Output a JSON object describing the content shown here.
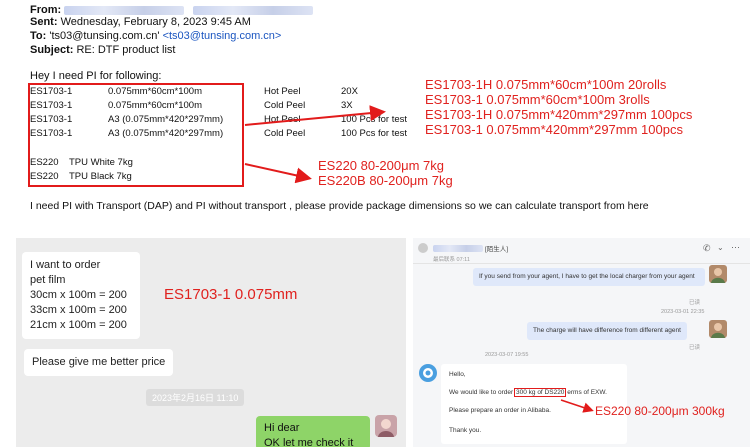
{
  "email": {
    "from_label": "From:",
    "sent_label": "Sent:",
    "sent_value": "Wednesday, February 8, 2023 9:45 AM",
    "to_label": "To:",
    "to_name": "'ts03@tunsing.com.cn'",
    "to_email": "<ts03@tunsing.com.cn>",
    "subject_label": "Subject:",
    "subject_value": "RE: DTF product list",
    "intro": "Hey I need PI for following:",
    "products": [
      {
        "code": "ES1703-1",
        "spec": "0.075mm*60cm*100m",
        "type": "Hot Peel",
        "qty": "20X"
      },
      {
        "code": "ES1703-1",
        "spec": "0.075mm*60cm*100m",
        "type": "Cold Peel",
        "qty": "3X"
      },
      {
        "code": "ES1703-1",
        "spec": "A3 (0.075mm*420*297mm)",
        "type": "Hot Peel",
        "qty": "100 Pcs for test"
      },
      {
        "code": "ES1703-1",
        "spec": "A3 (0.075mm*420*297mm)",
        "type": "Cold Peel",
        "qty": "100 Pcs for test"
      }
    ],
    "tpu": [
      {
        "code": "ES220",
        "spec": "TPU White 7kg"
      },
      {
        "code": "ES220",
        "spec": "TPU Black 7kg"
      }
    ],
    "closing": "I need PI with Transport (DAP) and PI without transport , please provide package dimensions so we can calculate transport from here"
  },
  "annotations": {
    "right_notes": [
      "ES1703-1H 0.075mm*60cm*100m 20rolls",
      "ES1703-1  0.075mm*60cm*100m 3rolls",
      "ES1703-1H 0.075mm*420mm*297mm 100pcs",
      "ES1703-1  0.075mm*420mm*297mm 100pcs"
    ],
    "tpu_notes": [
      "ES220   80-200μm 7kg",
      "ES220B 80-200μm 7kg"
    ],
    "chat_note": "ES1703-1 0.075mm",
    "bottom_note": "ES220 80-200μm 300kg",
    "color": "#e21b1b"
  },
  "chat_left": {
    "msg1_lines": [
      "I want to order",
      "pet film",
      "30cm x 100m = 200",
      "33cm x 100m = 200",
      "21cm x 100m = 200"
    ],
    "msg2": "Please give me better price",
    "timestamp": "2023年2月16日 11:10",
    "reply_lines": [
      "Hi dear",
      "OK let  me check it"
    ]
  },
  "chat_right": {
    "contact_tag": "[陌生人]",
    "last_seen": "最后联系 07:11",
    "msg1": "If you send from your agent, I have to get the local charger from your agent",
    "read1": "已读",
    "time2": "2023-03-01 22:35",
    "msg2": "The charge will have difference from different agent",
    "read2": "已读",
    "time3": "2023-03-07 19:55",
    "msg3_hello": "Hello,",
    "msg3_pre": "We would like to order",
    "msg3_hl": "300 kg of DS220",
    "msg3_post": "erms of EXW.",
    "msg3_line3": "Please prepare an order in Alibaba.",
    "msg3_thanks": "Thank you."
  }
}
